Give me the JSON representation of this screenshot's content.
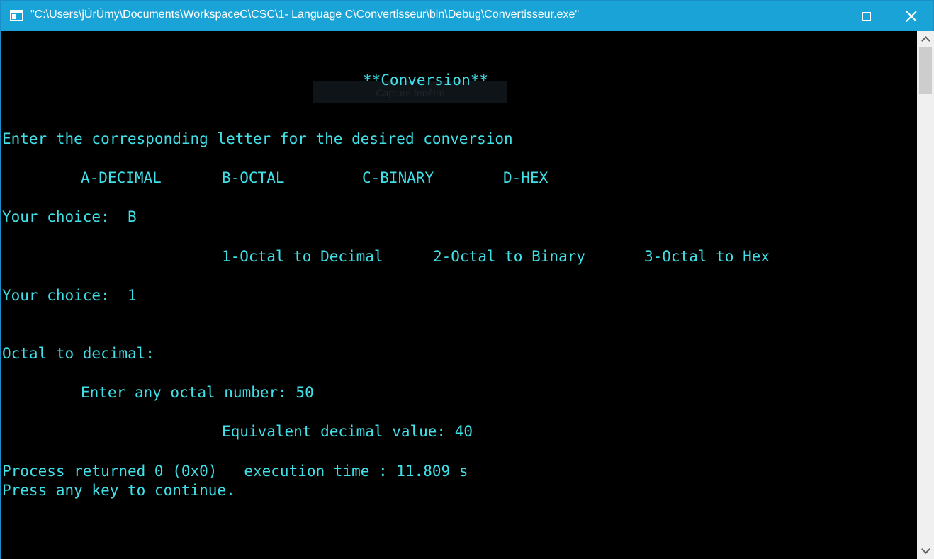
{
  "window": {
    "title": "\"C:\\Users\\jÚrÚmy\\Documents\\WorkspaceC\\CSC\\1- Language C\\Convertisseur\\bin\\Debug\\Convertisseur.exe\"",
    "buttons": {
      "minimize": "minimize",
      "maximize": "maximize",
      "close": "close"
    }
  },
  "console": {
    "ghost_overlay": "Capture fenêtre",
    "lines": {
      "heading": "**Conversion**",
      "prompt": "Enter the corresponding letter for the desired conversion",
      "opt_a": "A-DECIMAL",
      "opt_b": "B-OCTAL",
      "opt_c": "C-BINARY",
      "opt_d": "D-HEX",
      "choice1": "Your choice:  B",
      "sub_1": "1-Octal to Decimal",
      "sub_2": "2-Octal to Binary",
      "sub_3": "3-Octal to Hex",
      "choice2": "Your choice:  1",
      "section": "Octal to decimal:",
      "enter": "Enter any octal number: 50",
      "result": "Equivalent decimal value: 40",
      "process": "Process returned 0 (0x0)   execution time : 11.809 s",
      "press": "Press any key to continue."
    }
  },
  "colors": {
    "text": "#3fe0e8",
    "background": "#000000",
    "titlebar": "#1aa3d6"
  }
}
